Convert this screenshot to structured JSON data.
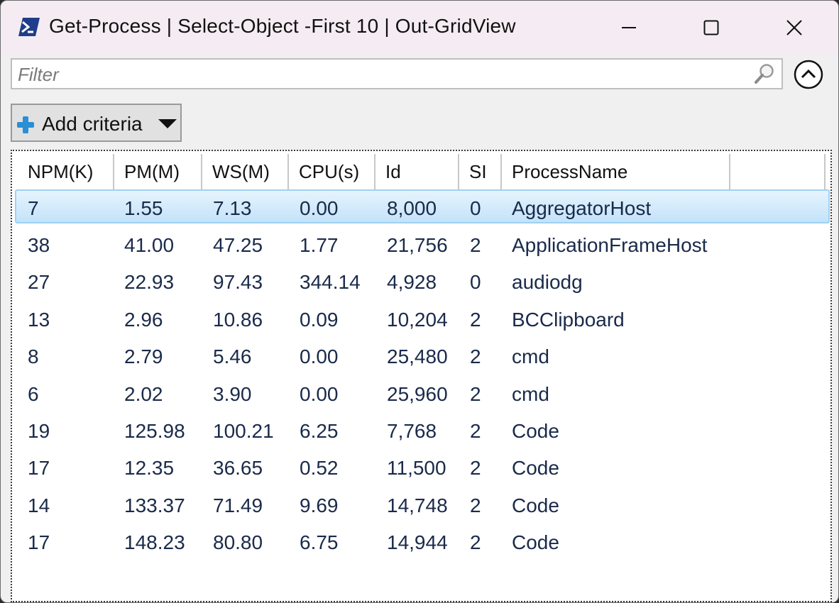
{
  "window": {
    "title": "Get-Process | Select-Object -First 10 | Out-GridView"
  },
  "filter": {
    "placeholder": "Filter"
  },
  "toolbar": {
    "add_criteria_label": "Add criteria"
  },
  "grid": {
    "columns": [
      "NPM(K)",
      "PM(M)",
      "WS(M)",
      "CPU(s)",
      "Id",
      "SI",
      "ProcessName",
      ""
    ],
    "selected_row": 0,
    "rows": [
      [
        "7",
        "1.55",
        "7.13",
        "0.00",
        "8,000",
        "0",
        "AggregatorHost"
      ],
      [
        "38",
        "41.00",
        "47.25",
        "1.77",
        "21,756",
        "2",
        "ApplicationFrameHost"
      ],
      [
        "27",
        "22.93",
        "97.43",
        "344.14",
        "4,928",
        "0",
        "audiodg"
      ],
      [
        "13",
        "2.96",
        "10.86",
        "0.09",
        "10,204",
        "2",
        "BCClipboard"
      ],
      [
        "8",
        "2.79",
        "5.46",
        "0.00",
        "25,480",
        "2",
        "cmd"
      ],
      [
        "6",
        "2.02",
        "3.90",
        "0.00",
        "25,960",
        "2",
        "cmd"
      ],
      [
        "19",
        "125.98",
        "100.21",
        "6.25",
        "7,768",
        "2",
        "Code"
      ],
      [
        "17",
        "12.35",
        "36.65",
        "0.52",
        "11,500",
        "2",
        "Code"
      ],
      [
        "14",
        "133.37",
        "71.49",
        "9.69",
        "14,748",
        "2",
        "Code"
      ],
      [
        "17",
        "148.23",
        "80.80",
        "6.75",
        "14,944",
        "2",
        "Code"
      ]
    ]
  },
  "colors": {
    "titlebar": "#f5ecf3",
    "selection": "#c3e3f9",
    "cell_text": "#1a2a4a",
    "powershell": "#1f3d8a"
  },
  "icons": [
    "powershell-icon",
    "minimize-icon",
    "maximize-icon",
    "close-icon",
    "search-icon",
    "collapse-icon",
    "plus-icon",
    "dropdown-caret-icon"
  ]
}
